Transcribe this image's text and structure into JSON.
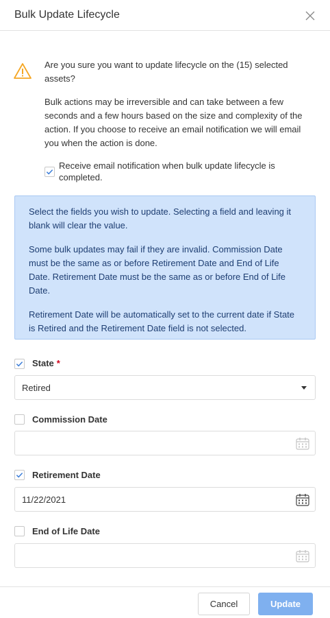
{
  "dialog": {
    "title": "Bulk Update Lifecycle"
  },
  "confirm": {
    "question": "Are you sure you want to update lifecycle on the (15) selected assets?",
    "warning": "Bulk actions may be irreversible and can take between a few seconds and a few hours based on the size and complexity of the action. If you choose to receive an email notification we will email you when the action is done.",
    "email_label": "Receive email notification when bulk update lifecycle is completed.",
    "email_checked": true
  },
  "info": {
    "p1": "Select the fields you wish to update. Selecting a field and leaving it blank will clear the value.",
    "p2": "Some bulk updates may fail if they are invalid. Commission Date must be the same as or before Retirement Date and End of Life Date. Retirement Date must be the same as or before End of Life Date.",
    "p3": "Retirement Date will be automatically set to the current date if State is Retired and the Retirement Date field is not selected."
  },
  "fields": {
    "state": {
      "label": "State",
      "required_mark": "*",
      "checked": true,
      "value": "Retired"
    },
    "commission_date": {
      "label": "Commission Date",
      "checked": false,
      "value": ""
    },
    "retirement_date": {
      "label": "Retirement Date",
      "checked": true,
      "value": "11/22/2021"
    },
    "end_of_life_date": {
      "label": "End of Life Date",
      "checked": false,
      "value": ""
    }
  },
  "footer": {
    "cancel_label": "Cancel",
    "update_label": "Update"
  },
  "colors": {
    "accent": "#7fb0ef",
    "info_bg": "#d0e3fb",
    "info_text": "#1e3e72",
    "warning": "#f5a623",
    "required": "#d0021b"
  },
  "icons": {
    "close": "close-icon",
    "warning": "warning-icon",
    "calendar": "calendar-icon",
    "dropdown": "chevron-down-icon",
    "check": "check-icon"
  }
}
